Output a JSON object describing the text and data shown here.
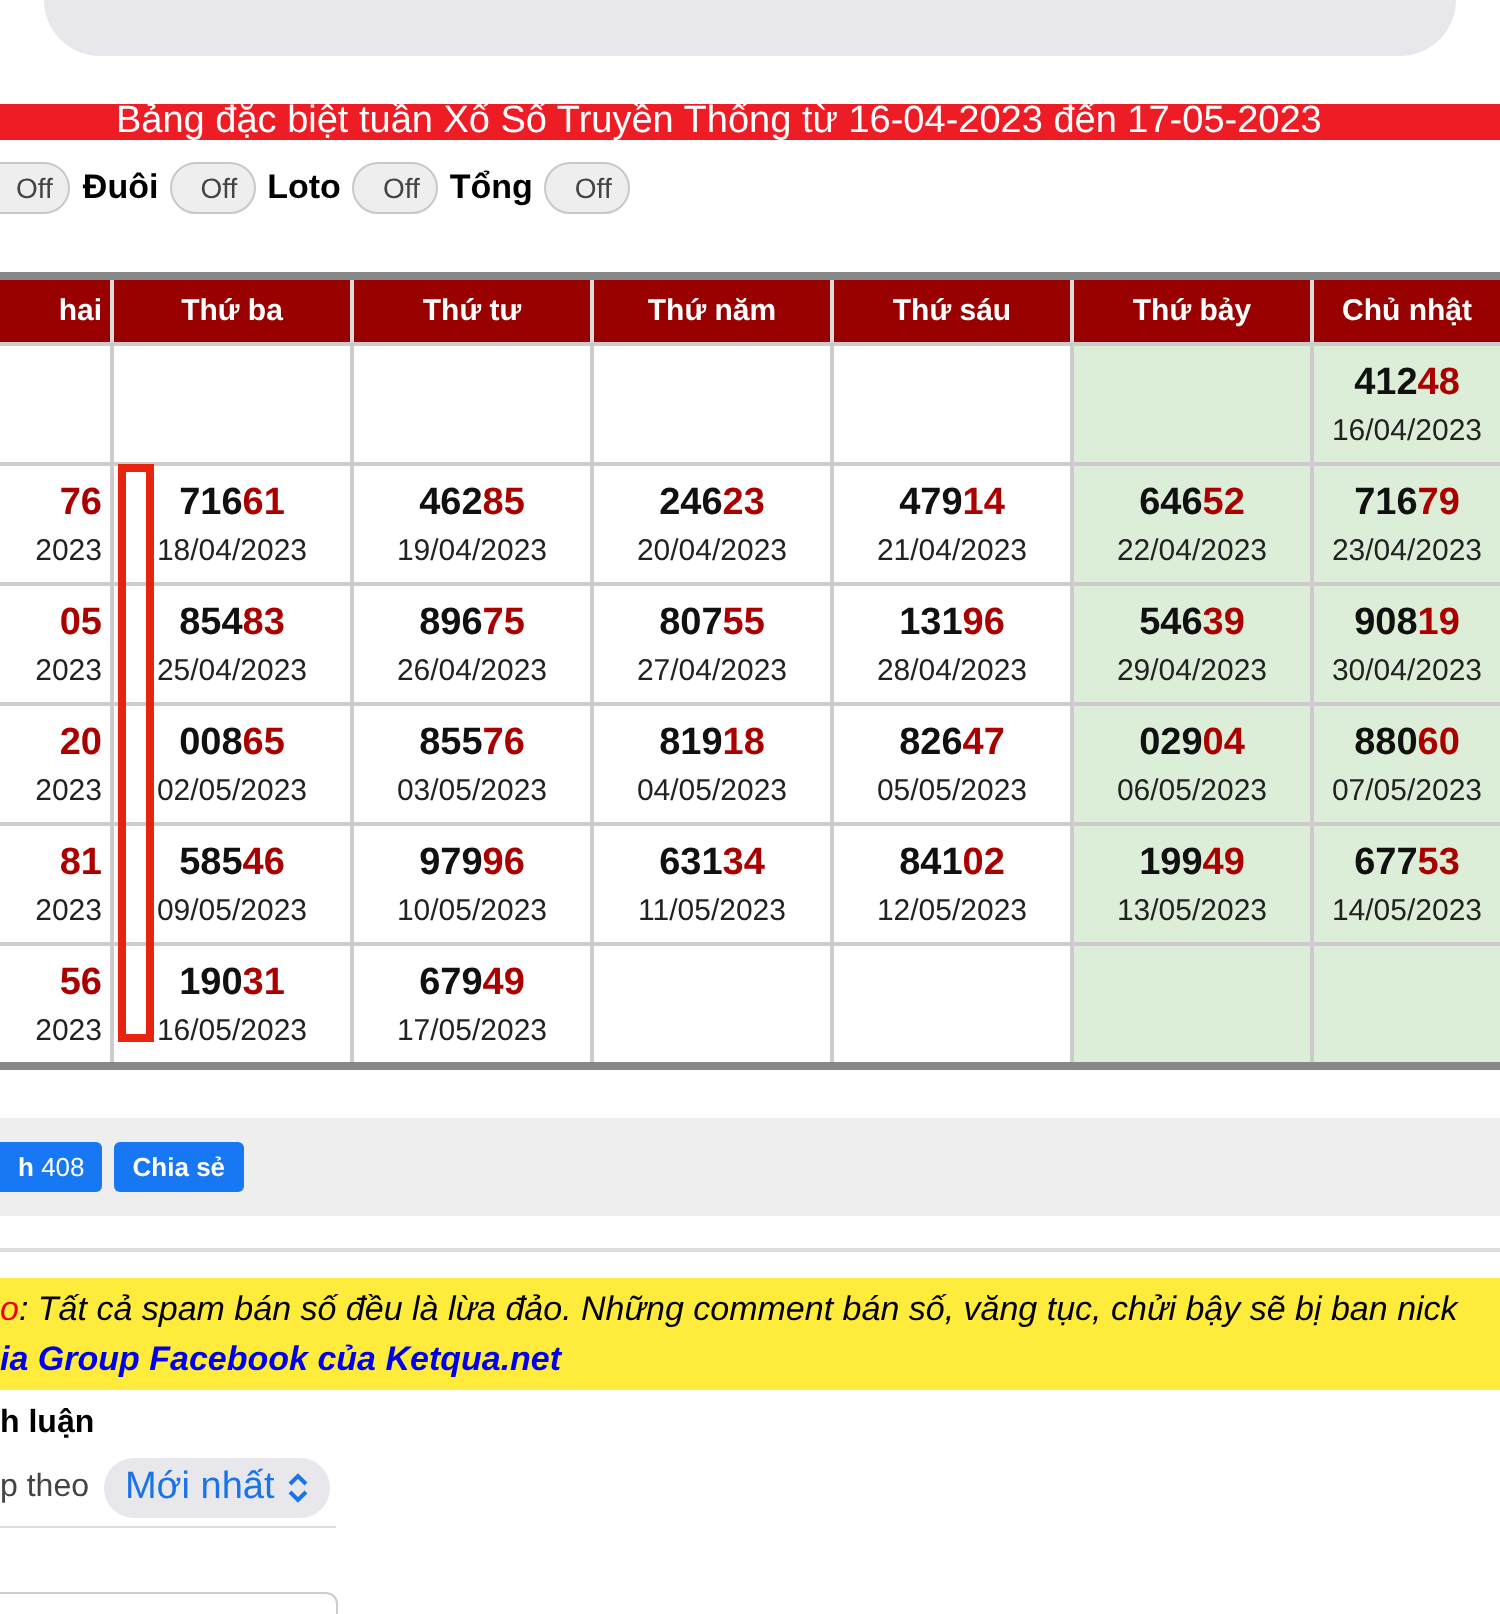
{
  "banner": {
    "title": "Bảng đặc biệt tuần Xổ Số Truyền Thống từ 16-04-2023 đến 17-05-2023"
  },
  "toggles": [
    {
      "state": "Off",
      "on": false
    },
    {
      "label": "Đuôi",
      "state": "Off",
      "on": false
    },
    {
      "label": "Loto",
      "state": "Off",
      "on": false
    },
    {
      "label": "Tổng",
      "state": "Off",
      "on": false
    }
  ],
  "table": {
    "columns": [
      {
        "label": "hai",
        "weekend": false
      },
      {
        "label": "Thứ ba",
        "weekend": false
      },
      {
        "label": "Thứ tư",
        "weekend": false
      },
      {
        "label": "Thứ năm",
        "weekend": false
      },
      {
        "label": "Thứ sáu",
        "weekend": false
      },
      {
        "label": "Thứ bảy",
        "weekend": true
      },
      {
        "label": "Chủ nhật",
        "weekend": true
      }
    ],
    "rows": [
      [
        null,
        null,
        null,
        null,
        null,
        null,
        {
          "head": "412",
          "tail": "48",
          "date": "16/04/2023"
        }
      ],
      [
        {
          "tail": "76",
          "date": "2023"
        },
        {
          "head": "716",
          "tail": "61",
          "date": "18/04/2023"
        },
        {
          "head": "462",
          "tail": "85",
          "date": "19/04/2023"
        },
        {
          "head": "246",
          "tail": "23",
          "date": "20/04/2023"
        },
        {
          "head": "479",
          "tail": "14",
          "date": "21/04/2023"
        },
        {
          "head": "646",
          "tail": "52",
          "date": "22/04/2023"
        },
        {
          "head": "716",
          "tail": "79",
          "date": "23/04/2023"
        }
      ],
      [
        {
          "tail": "05",
          "date": "2023"
        },
        {
          "head": "854",
          "tail": "83",
          "date": "25/04/2023"
        },
        {
          "head": "896",
          "tail": "75",
          "date": "26/04/2023"
        },
        {
          "head": "807",
          "tail": "55",
          "date": "27/04/2023"
        },
        {
          "head": "131",
          "tail": "96",
          "date": "28/04/2023"
        },
        {
          "head": "546",
          "tail": "39",
          "date": "29/04/2023"
        },
        {
          "head": "908",
          "tail": "19",
          "date": "30/04/2023"
        }
      ],
      [
        {
          "tail": "20",
          "date": "2023"
        },
        {
          "head": "008",
          "tail": "65",
          "date": "02/05/2023"
        },
        {
          "head": "855",
          "tail": "76",
          "date": "03/05/2023"
        },
        {
          "head": "819",
          "tail": "18",
          "date": "04/05/2023"
        },
        {
          "head": "826",
          "tail": "47",
          "date": "05/05/2023"
        },
        {
          "head": "029",
          "tail": "04",
          "date": "06/05/2023"
        },
        {
          "head": "880",
          "tail": "60",
          "date": "07/05/2023"
        }
      ],
      [
        {
          "tail": "81",
          "date": "2023"
        },
        {
          "head": "585",
          "tail": "46",
          "date": "09/05/2023"
        },
        {
          "head": "979",
          "tail": "96",
          "date": "10/05/2023"
        },
        {
          "head": "631",
          "tail": "34",
          "date": "11/05/2023"
        },
        {
          "head": "841",
          "tail": "02",
          "date": "12/05/2023"
        },
        {
          "head": "199",
          "tail": "49",
          "date": "13/05/2023"
        },
        {
          "head": "677",
          "tail": "53",
          "date": "14/05/2023"
        }
      ],
      [
        {
          "tail": "56",
          "date": "2023"
        },
        {
          "head": "190",
          "tail": "31",
          "date": "16/05/2023"
        },
        {
          "head": "679",
          "tail": "49",
          "date": "17/05/2023"
        },
        null,
        null,
        null,
        null
      ]
    ]
  },
  "share_bar": {
    "like_button": {
      "label": "h",
      "count": "408"
    },
    "share_button": "Chia sẻ"
  },
  "notice": {
    "prefix": "o",
    "text": ": Tất cả spam bán số đều là lừa đảo. Những comment bán số, văng tục, chửi bậy sẽ bị ban nick",
    "link": "ia Group Facebook của Ketqua.net"
  },
  "comments": {
    "heading": "h luận",
    "sort_label": "p theo",
    "sort_value": "Mới nhất"
  }
}
